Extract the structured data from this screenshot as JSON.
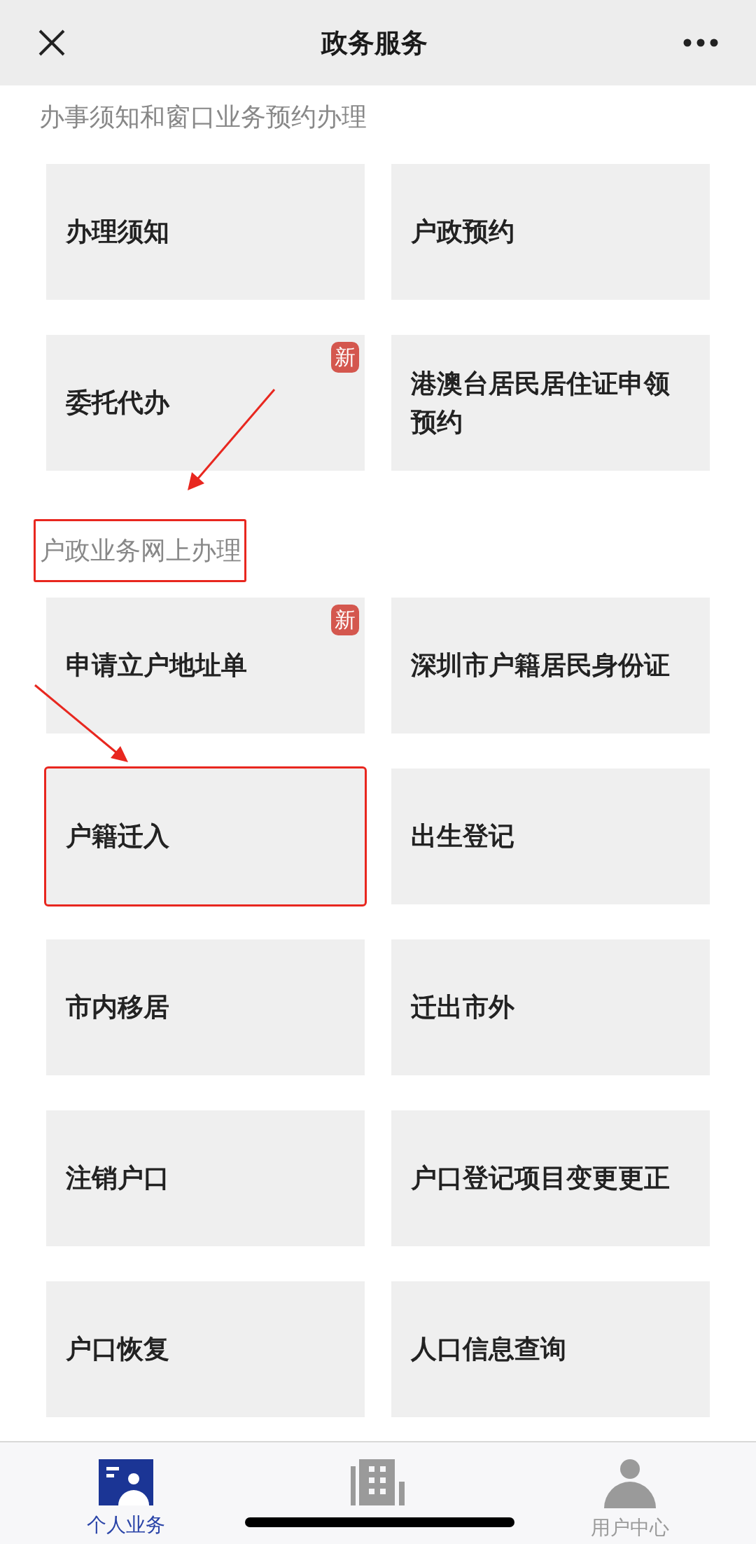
{
  "header": {
    "title": "政务服务"
  },
  "sections": [
    {
      "title": "办事须知和窗口业务预约办理",
      "highlighted": false,
      "items": [
        {
          "label": "办理须知",
          "highlighted": false
        },
        {
          "label": "户政预约",
          "highlighted": false
        },
        {
          "label": "委托代办",
          "badge": "新",
          "highlighted": false
        },
        {
          "label": "港澳台居民居住证申领预约",
          "highlighted": false
        }
      ]
    },
    {
      "title": "户政业务网上办理",
      "highlighted": true,
      "items": [
        {
          "label": "申请立户地址单",
          "badge": "新",
          "highlighted": false
        },
        {
          "label": "深圳市户籍居民身份证",
          "highlighted": false
        },
        {
          "label": "户籍迁入",
          "highlighted": true
        },
        {
          "label": "出生登记",
          "highlighted": false
        },
        {
          "label": "市内移居",
          "highlighted": false
        },
        {
          "label": "迁出市外",
          "highlighted": false
        },
        {
          "label": "注销户口",
          "highlighted": false
        },
        {
          "label": "户口登记项目变更更正",
          "highlighted": false
        },
        {
          "label": "户口恢复",
          "highlighted": false
        },
        {
          "label": "人口信息查询",
          "highlighted": false
        }
      ]
    }
  ],
  "tabs": [
    {
      "label": "个人业务",
      "kind": "card",
      "selected": true
    },
    {
      "kind": "building",
      "selected": false
    },
    {
      "label": "用户中心",
      "kind": "person",
      "selected": false
    }
  ]
}
